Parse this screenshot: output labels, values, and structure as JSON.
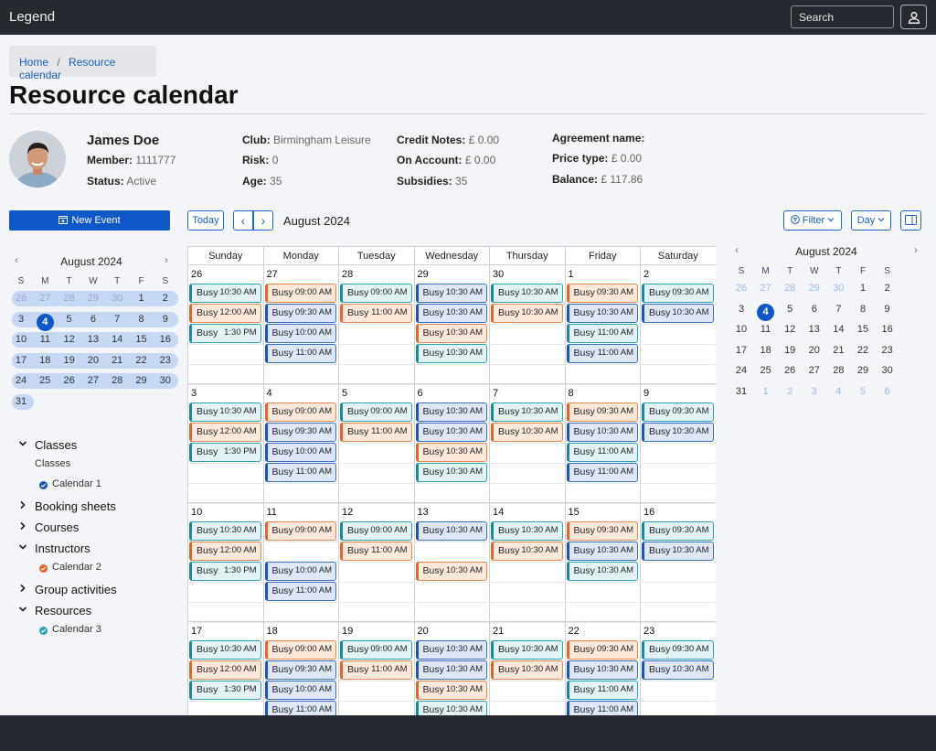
{
  "app": {
    "brand": "Legend",
    "search_placeholder": "Search"
  },
  "breadcrumb": {
    "home": "Home",
    "sep": "/",
    "current": "Resource calendar"
  },
  "page_title": "Resource calendar",
  "member": {
    "name": "James Doe",
    "fields": [
      {
        "label": "Member:",
        "value": "1111777"
      },
      {
        "label": "Status:",
        "value": "Active"
      },
      {
        "label": "Club:",
        "value": "Birmingham Leisure"
      },
      {
        "label": "Risk:",
        "value": "0"
      },
      {
        "label": "Age:",
        "value": "35"
      },
      {
        "label": "Credit Notes:",
        "value": "£ 0.00"
      },
      {
        "label": "On Account:",
        "value": "£ 0.00"
      },
      {
        "label": "Subsidies:",
        "value": "35"
      },
      {
        "label": "Agreement name:",
        "value": ""
      },
      {
        "label": "Price type:",
        "value": "£ 0.00"
      },
      {
        "label": "Balance:",
        "value": "£ 117.86"
      }
    ]
  },
  "new_event_label": "New Event",
  "mini_left": {
    "title": "August 2024",
    "prev": "‹",
    "next": "›",
    "dow": [
      "S",
      "M",
      "T",
      "W",
      "T",
      "F",
      "S"
    ],
    "weeks": [
      [
        "26",
        "27",
        "28",
        "29",
        "30",
        "1",
        "2"
      ],
      [
        "3",
        "4",
        "5",
        "6",
        "7",
        "8",
        "9"
      ],
      [
        "10",
        "11",
        "12",
        "13",
        "14",
        "15",
        "16"
      ],
      [
        "17",
        "18",
        "19",
        "20",
        "21",
        "22",
        "23"
      ],
      [
        "24",
        "25",
        "26",
        "27",
        "28",
        "29",
        "30"
      ],
      [
        "31",
        "",
        "",
        "",
        "",
        "",
        ""
      ]
    ],
    "selected": "4"
  },
  "mini_right": {
    "title": "August 2024",
    "prev": "‹",
    "next": "›",
    "dow": [
      "S",
      "M",
      "T",
      "W",
      "T",
      "F",
      "S"
    ],
    "weeks": [
      [
        "26",
        "27",
        "28",
        "29",
        "30",
        "1",
        "2"
      ],
      [
        "3",
        "4",
        "5",
        "6",
        "7",
        "8",
        "9"
      ],
      [
        "10",
        "11",
        "12",
        "13",
        "14",
        "15",
        "16"
      ],
      [
        "17",
        "18",
        "19",
        "20",
        "21",
        "22",
        "23"
      ],
      [
        "24",
        "25",
        "26",
        "27",
        "28",
        "29",
        "30"
      ],
      [
        "31",
        "1",
        "2",
        "3",
        "4",
        "5",
        "6"
      ]
    ],
    "selected": "4"
  },
  "tree": [
    {
      "label": "Classes",
      "expanded": true,
      "children": [
        {
          "label": "Classes",
          "type": "text"
        },
        {
          "label": "Calendar 1",
          "type": "calendar",
          "color": "#1c55b8"
        }
      ]
    },
    {
      "label": "Booking sheets",
      "expanded": false,
      "children": []
    },
    {
      "label": "Courses",
      "expanded": false,
      "children": []
    },
    {
      "label": "Instructors",
      "expanded": true,
      "children": [
        {
          "label": "Calendar 2",
          "type": "calendar",
          "color": "#e2652a"
        }
      ]
    },
    {
      "label": "Group activities",
      "expanded": false,
      "children": []
    },
    {
      "label": "Resources",
      "expanded": true,
      "children": [
        {
          "label": "Calendar 3",
          "type": "calendar",
          "color": "#2aa4b3"
        }
      ]
    }
  ],
  "toolbar": {
    "today": "Today",
    "prev": "‹",
    "next": "›",
    "month_label": "August 2024",
    "filter": "Filter",
    "view": "Day"
  },
  "weekdays": [
    "Sunday",
    "Monday",
    "Tuesday",
    "Wednesday",
    "Thursday",
    "Friday",
    "Saturday"
  ],
  "calendar_weeks": [
    {
      "days": [
        {
          "d": "26",
          "ev": [
            [
              "t",
              "Busy",
              "10:30 AM"
            ],
            [
              "o",
              "Busy",
              "12:00 AM"
            ],
            [
              "t",
              "Busy",
              "1:30 PM"
            ]
          ]
        },
        {
          "d": "27",
          "ev": [
            [
              "o",
              "Busy",
              "09:00 AM"
            ],
            [
              "b",
              "Busy",
              "09:30 AM"
            ],
            [
              "b",
              "Busy",
              "10:00 AM"
            ],
            [
              "b",
              "Busy",
              "11:00 AM"
            ]
          ]
        },
        {
          "d": "28",
          "ev": [
            [
              "t",
              "Busy",
              "09:00 AM"
            ],
            [
              "o",
              "Busy",
              "11:00 AM"
            ]
          ]
        },
        {
          "d": "29",
          "ev": [
            [
              "b",
              "Busy",
              "10:30 AM"
            ],
            [
              "b",
              "Busy",
              "10:30 AM"
            ],
            [
              "o",
              "Busy",
              "10:30 AM"
            ],
            [
              "t",
              "Busy",
              "10:30 AM"
            ]
          ]
        },
        {
          "d": "30",
          "ev": [
            [
              "t",
              "Busy",
              "10:30 AM"
            ],
            [
              "o",
              "Busy",
              "10:30 AM"
            ]
          ]
        },
        {
          "d": "1",
          "ev": [
            [
              "o",
              "Busy",
              "09:30 AM"
            ],
            [
              "b",
              "Busy",
              "10:30 AM"
            ],
            [
              "t",
              "Busy",
              "11:00 AM"
            ],
            [
              "b",
              "Busy",
              "11:00 AM"
            ]
          ]
        },
        {
          "d": "2",
          "ev": [
            [
              "t",
              "Busy",
              "09:30 AM"
            ],
            [
              "b",
              "Busy",
              "10:30 AM"
            ]
          ]
        }
      ]
    },
    {
      "days": [
        {
          "d": "3",
          "ev": [
            [
              "t",
              "Busy",
              "10:30 AM"
            ],
            [
              "o",
              "Busy",
              "12:00 AM"
            ],
            [
              "t",
              "Busy",
              "1:30 PM"
            ]
          ]
        },
        {
          "d": "4",
          "ev": [
            [
              "o",
              "Busy",
              "09:00 AM"
            ],
            [
              "b",
              "Busy",
              "09:30 AM"
            ],
            [
              "b",
              "Busy",
              "10:00 AM"
            ],
            [
              "b",
              "Busy",
              "11:00 AM"
            ]
          ]
        },
        {
          "d": "5",
          "ev": [
            [
              "t",
              "Busy",
              "09:00 AM"
            ],
            [
              "o",
              "Busy",
              "11:00 AM"
            ]
          ]
        },
        {
          "d": "6",
          "ev": [
            [
              "b",
              "Busy",
              "10:30 AM"
            ],
            [
              "b",
              "Busy",
              "10:30 AM"
            ],
            [
              "o",
              "Busy",
              "10:30 AM"
            ],
            [
              "t",
              "Busy",
              "10:30 AM"
            ]
          ]
        },
        {
          "d": "7",
          "ev": [
            [
              "t",
              "Busy",
              "10:30 AM"
            ],
            [
              "o",
              "Busy",
              "10:30 AM"
            ]
          ]
        },
        {
          "d": "8",
          "ev": [
            [
              "o",
              "Busy",
              "09:30 AM"
            ],
            [
              "b",
              "Busy",
              "10:30 AM"
            ],
            [
              "t",
              "Busy",
              "11:00 AM"
            ],
            [
              "b",
              "Busy",
              "11:00 AM"
            ]
          ]
        },
        {
          "d": "9",
          "ev": [
            [
              "t",
              "Busy",
              "09:30 AM"
            ],
            [
              "b",
              "Busy",
              "10:30 AM"
            ]
          ]
        }
      ]
    },
    {
      "days": [
        {
          "d": "10",
          "ev": [
            [
              "t",
              "Busy",
              "10:30 AM"
            ],
            [
              "o",
              "Busy",
              "12:00 AM"
            ],
            [
              "t",
              "Busy",
              "1:30 PM"
            ]
          ]
        },
        {
          "d": "11",
          "ev": [
            [
              "o",
              "Busy",
              "09:00 AM"
            ],
            null,
            [
              "b",
              "Busy",
              "10:00 AM"
            ],
            [
              "b",
              "Busy",
              "11:00 AM"
            ]
          ]
        },
        {
          "d": "12",
          "ev": [
            [
              "t",
              "Busy",
              "09:00 AM"
            ],
            [
              "o",
              "Busy",
              "11:00 AM"
            ]
          ]
        },
        {
          "d": "13",
          "ev": [
            [
              "b",
              "Busy",
              "10:30 AM"
            ],
            null,
            [
              "o",
              "Busy",
              "10:30 AM"
            ]
          ]
        },
        {
          "d": "14",
          "ev": [
            [
              "t",
              "Busy",
              "10:30 AM"
            ],
            [
              "o",
              "Busy",
              "10:30 AM"
            ]
          ]
        },
        {
          "d": "15",
          "ev": [
            [
              "o",
              "Busy",
              "09:30 AM"
            ],
            [
              "b",
              "Busy",
              "10:30 AM"
            ],
            [
              "t",
              "Busy",
              "10:30 AM"
            ]
          ]
        },
        {
          "d": "16",
          "ev": [
            [
              "t",
              "Busy",
              "09:30 AM"
            ],
            [
              "b",
              "Busy",
              "10:30 AM"
            ]
          ]
        }
      ]
    },
    {
      "days": [
        {
          "d": "17",
          "ev": [
            [
              "t",
              "Busy",
              "10:30 AM"
            ],
            [
              "o",
              "Busy",
              "12:00 AM"
            ],
            [
              "t",
              "Busy",
              "1:30 PM"
            ]
          ]
        },
        {
          "d": "18",
          "ev": [
            [
              "o",
              "Busy",
              "09:00 AM"
            ],
            [
              "b",
              "Busy",
              "09:30 AM"
            ],
            [
              "b",
              "Busy",
              "10:00 AM"
            ],
            [
              "b",
              "Busy",
              "11:00 AM"
            ]
          ]
        },
        {
          "d": "19",
          "ev": [
            [
              "t",
              "Busy",
              "09:00 AM"
            ],
            [
              "o",
              "Busy",
              "11:00 AM"
            ]
          ]
        },
        {
          "d": "20",
          "ev": [
            [
              "b",
              "Busy",
              "10:30 AM"
            ],
            [
              "b",
              "Busy",
              "10:30 AM"
            ],
            [
              "o",
              "Busy",
              "10:30 AM"
            ],
            [
              "t",
              "Busy",
              "10:30 AM"
            ]
          ]
        },
        {
          "d": "21",
          "ev": [
            [
              "t",
              "Busy",
              "10:30 AM"
            ],
            [
              "o",
              "Busy",
              "10:30 AM"
            ]
          ]
        },
        {
          "d": "22",
          "ev": [
            [
              "o",
              "Busy",
              "09:30 AM"
            ],
            [
              "b",
              "Busy",
              "10:30 AM"
            ],
            [
              "t",
              "Busy",
              "11:00 AM"
            ],
            [
              "b",
              "Busy",
              "11:00 AM"
            ]
          ]
        },
        {
          "d": "23",
          "ev": [
            [
              "t",
              "Busy",
              "09:30 AM"
            ],
            [
              "b",
              "Busy",
              "10:30 AM"
            ]
          ]
        }
      ]
    }
  ]
}
